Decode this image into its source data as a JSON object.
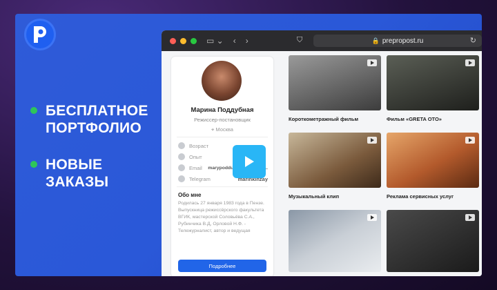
{
  "promo": {
    "bullets": [
      {
        "text": "БЕСПЛАТНОЕ ПОРТФОЛИО"
      },
      {
        "text": "НОВЫЕ ЗАКАЗЫ"
      }
    ]
  },
  "browser": {
    "url": "prepropost.ru"
  },
  "profile": {
    "name": "Марина Поддубная",
    "role": "Режиссер-постановщик",
    "city": "Москва",
    "fields": [
      {
        "label": "Возраст",
        "value": ""
      },
      {
        "label": "Опыт",
        "value": ""
      },
      {
        "label": "Email",
        "value": "marypoddubnaya@gmail..."
      },
      {
        "label": "Telegram",
        "value": "marinkinzay"
      }
    ],
    "about_title": "Обо мне",
    "about_text": "Родилась 27 января 1983 года в Пензе. Выпускница режиссёрского факультета ВГИК, мастерской Соловьёва С.А., Рубинчика В.Д, Орловой Н.Ф. - Тележурналист, автор и ведущая",
    "more_button": "Подробнее"
  },
  "videos": [
    {
      "caption": "Короткометражный фильм"
    },
    {
      "caption": "Фильм «GRETA OTO»"
    },
    {
      "caption": "Музыкальный клип"
    },
    {
      "caption": "Реклама сервисных услуг"
    },
    {
      "caption": ""
    },
    {
      "caption": ""
    }
  ],
  "colors": {
    "accent": "#2165e8",
    "bullet": "#2ec55a",
    "play": "#29b6f6"
  }
}
